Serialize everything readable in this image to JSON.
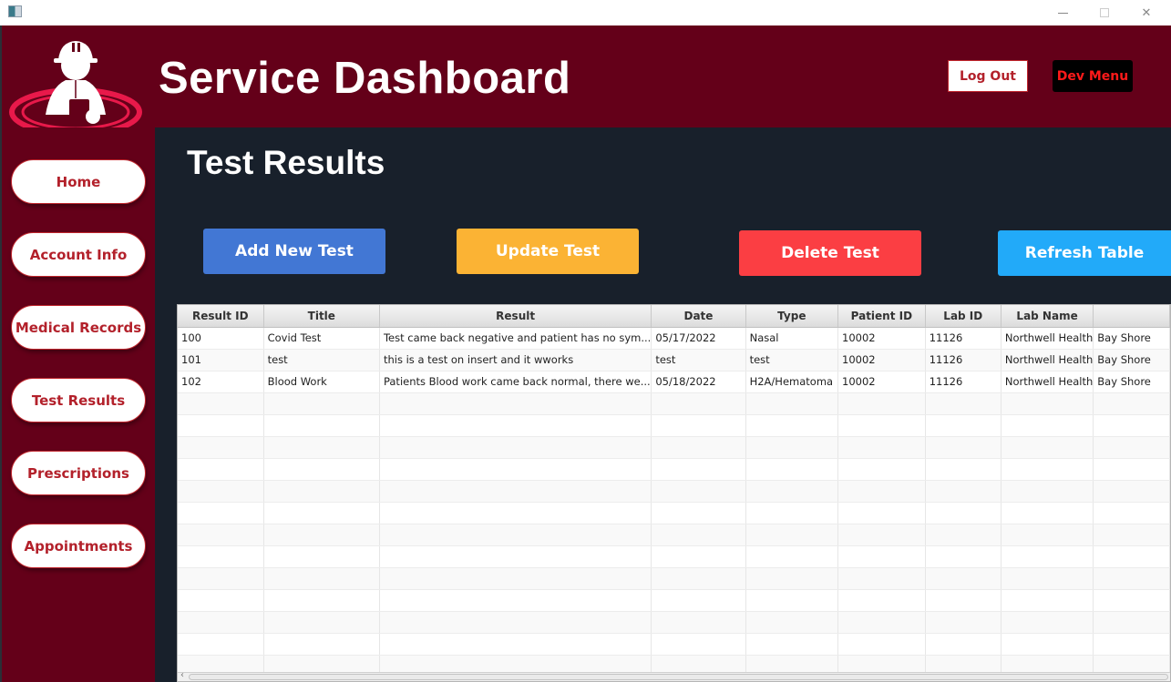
{
  "window": {
    "minimize_glyph": "",
    "close_glyph": "✕"
  },
  "header": {
    "title": "Service Dashboard",
    "logout_label": "Log Out",
    "dev_menu_label": "Dev Menu"
  },
  "sidebar": {
    "items": [
      {
        "label": "Home"
      },
      {
        "label": "Account Info"
      },
      {
        "label": "Medical Records"
      },
      {
        "label": "Test Results"
      },
      {
        "label": "Prescriptions"
      },
      {
        "label": "Appointments"
      }
    ]
  },
  "main": {
    "page_title": "Test Results",
    "buttons": {
      "add": "Add New Test",
      "update": "Update Test",
      "delete": "Delete Test",
      "refresh": "Refresh Table"
    },
    "table": {
      "columns": [
        "Result ID",
        "Title",
        "Result",
        "Date",
        "Type",
        "Patient ID",
        "Lab ID",
        "Lab Name",
        ""
      ],
      "rows": [
        [
          "100",
          "Covid Test",
          "Test came back negative and patient has no sym...",
          "05/17/2022",
          "Nasal",
          "10002",
          "11126",
          "Northwell Health",
          "Bay Shore"
        ],
        [
          "101",
          "test",
          "this is a test on insert and it wworks",
          "test",
          "test",
          "10002",
          "11126",
          "Northwell Health",
          "Bay Shore"
        ],
        [
          "102",
          "Blood Work",
          "Patients Blood work came back normal, there we...",
          "05/18/2022",
          "H2A/Hematoma",
          "10002",
          "11126",
          "Northwell Health",
          "Bay Shore"
        ]
      ],
      "empty_rows": 13
    }
  },
  "colors": {
    "brand_maroon": "#640019",
    "main_bg": "#18202b",
    "add": "#4277d4",
    "update": "#fbb334",
    "delete": "#fb3e43",
    "refresh": "#22aaf9",
    "nav_text": "#b3212b"
  }
}
